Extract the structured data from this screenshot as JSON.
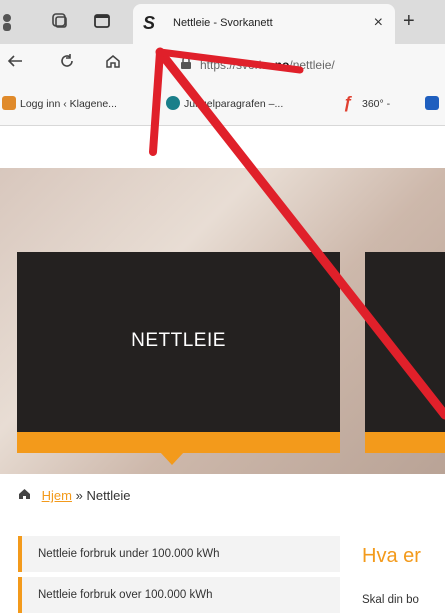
{
  "browser": {
    "tab": {
      "title": "Nettleie - Svorkanett",
      "close_glyph": "×",
      "logo_glyph": "S"
    },
    "new_tab_glyph": "+",
    "url": {
      "prefix": "https://svorka.",
      "domain": "no",
      "path": "/nettleie/"
    },
    "bookmarks": [
      {
        "label": "Logg inn ‹ Klagene..."
      },
      {
        "label": "Jungelparagrafen –..."
      },
      {
        "label": "360° -"
      }
    ]
  },
  "hero": {
    "card_title": "NETTLEIE"
  },
  "breadcrumb": {
    "home": "Hjem",
    "separator": "»",
    "current": "Nettleie"
  },
  "sidemenu": {
    "items": [
      {
        "label": "Nettleie forbruk under 100.000 kWh"
      },
      {
        "label": "Nettleie forbruk over 100.000 kWh"
      }
    ]
  },
  "content": {
    "title": "Hva er",
    "text": "Skal din bo"
  },
  "colors": {
    "accent": "#f39a1b",
    "card": "#242120",
    "annotation": "#e0202a"
  }
}
